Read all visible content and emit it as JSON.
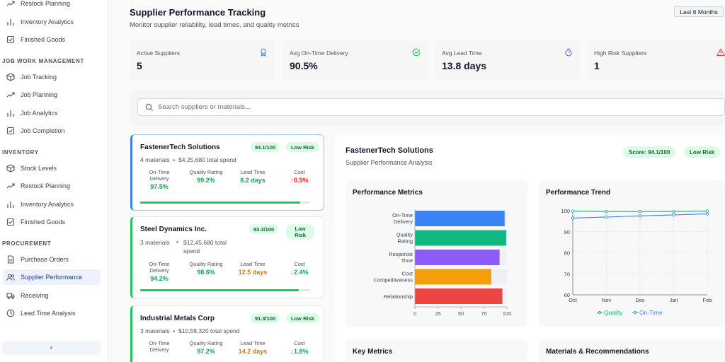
{
  "sidebar": {
    "top_items": [
      {
        "label": "Restock Planning",
        "icon": "trend-icon"
      },
      {
        "label": "Inventory Analytics",
        "icon": "bar-icon"
      },
      {
        "label": "Finished Goods",
        "icon": "check-icon"
      }
    ],
    "sections": [
      {
        "title": "JOB WORK MANAGEMENT",
        "items": [
          {
            "label": "Job Tracking",
            "icon": "box-icon"
          },
          {
            "label": "Job Planning",
            "icon": "trend-icon"
          },
          {
            "label": "Job Analytics",
            "icon": "bar-icon"
          },
          {
            "label": "Job Completion",
            "icon": "check-icon"
          }
        ]
      },
      {
        "title": "INVENTORY",
        "items": [
          {
            "label": "Stock Levels",
            "icon": "box-icon"
          },
          {
            "label": "Restock Planning",
            "icon": "trend-icon"
          },
          {
            "label": "Inventory Analytics",
            "icon": "bar-icon"
          },
          {
            "label": "Finished Goods",
            "icon": "check-icon"
          }
        ]
      },
      {
        "title": "PROCUREMENT",
        "items": [
          {
            "label": "Purchase Orders",
            "icon": "document-icon"
          },
          {
            "label": "Supplier Performance",
            "icon": "users-icon",
            "active": true
          },
          {
            "label": "Receiving",
            "icon": "truck-icon"
          },
          {
            "label": "Lead Time Analysis",
            "icon": "clock-icon"
          }
        ]
      }
    ],
    "collapse_label": "‹"
  },
  "header": {
    "title": "Supplier Performance Tracking",
    "subtitle": "Monitor supplier reliability, lead times, and quality metrics",
    "period": "Last 6 Months"
  },
  "stats": [
    {
      "label": "Active Suppliers",
      "value": "5",
      "icon": "award-icon",
      "color": "#3b82f6"
    },
    {
      "label": "Avg On-Time Delivery",
      "value": "90.5%",
      "icon": "check-circle-icon",
      "color": "#22c55e"
    },
    {
      "label": "Avg Lead Time",
      "value": "13.8 days",
      "icon": "timer-icon",
      "color": "#8b5cf6"
    },
    {
      "label": "High Risk Suppliers",
      "value": "1",
      "icon": "warning-icon",
      "color": "#ef4444"
    }
  ],
  "search": {
    "placeholder": "Search suppliers or materials..."
  },
  "col_labels": {
    "ontime": "On-Time Delivery",
    "quality": "Quality Rating",
    "lead": "Lead Time",
    "cost": "Cost"
  },
  "suppliers": [
    {
      "name": "FastenerTech Solutions",
      "score": "94.1/100",
      "risk": "Low Risk",
      "materials": "4 materials",
      "spend": "$4,25,680 total spend",
      "ontime": "97.5%",
      "quality": "99.2%",
      "lead": "8.2 days",
      "cost": "↑0.5%",
      "score_value": 94.1
    },
    {
      "name": "Steel Dynamics Inc.",
      "score": "93.3/100",
      "risk": "Low Risk",
      "materials": "3 materials",
      "spend": "$12,45,680 total spend",
      "ontime": "94.2%",
      "quality": "98.6%",
      "lead": "12.5 days",
      "cost": "↓2.4%",
      "score_value": 93.3
    },
    {
      "name": "Industrial Metals Corp",
      "score": "91.3/100",
      "risk": "Low Risk",
      "materials": "3 materials",
      "spend": "$10,58,320 total spend",
      "ontime": "",
      "quality": "97.2%",
      "lead": "14.2 days",
      "cost": "↓1.8%",
      "score_value": 91.3
    }
  ],
  "detail": {
    "title": "FastenerTech Solutions",
    "subtitle": "Supplier Performance Analysis",
    "score": "Score: 94.1/100",
    "risk": "Low Risk",
    "panels": {
      "metrics": "Performance Metrics",
      "trend": "Performance Trend",
      "key": "Key Metrics",
      "materials": "Materials & Recommendations"
    }
  },
  "chart_data": [
    {
      "type": "bar",
      "orientation": "horizontal",
      "title": "Performance Metrics",
      "categories": [
        "On-Time Delivery",
        "Quality Rating",
        "Response Time",
        "Cost Competitiveness",
        "Relationship"
      ],
      "values": [
        97.5,
        99.2,
        92,
        83,
        95
      ],
      "colors": [
        "#3b82f6",
        "#10b981",
        "#8b5cf6",
        "#f59e0b",
        "#ef4444"
      ],
      "xlim": [
        0,
        100
      ],
      "xticks": [
        "0",
        "25",
        "50",
        "75",
        "100"
      ]
    },
    {
      "type": "line",
      "title": "Performance Trend",
      "x": [
        "Oct",
        "Nov",
        "Dec",
        "Jan",
        "Feb"
      ],
      "series": [
        {
          "name": "Quality",
          "values": [
            99.8,
            99.6,
            99.6,
            99.6,
            99.8
          ],
          "color": "#10b981"
        },
        {
          "name": "On-Time",
          "values": [
            96.5,
            97.0,
            97.5,
            98.0,
            98.5
          ],
          "color": "#3b82f6"
        }
      ],
      "ylim": [
        60,
        100
      ],
      "yticks": [
        "60",
        "70",
        "80",
        "90",
        "100"
      ],
      "legend": "bottom",
      "grid": true
    }
  ]
}
